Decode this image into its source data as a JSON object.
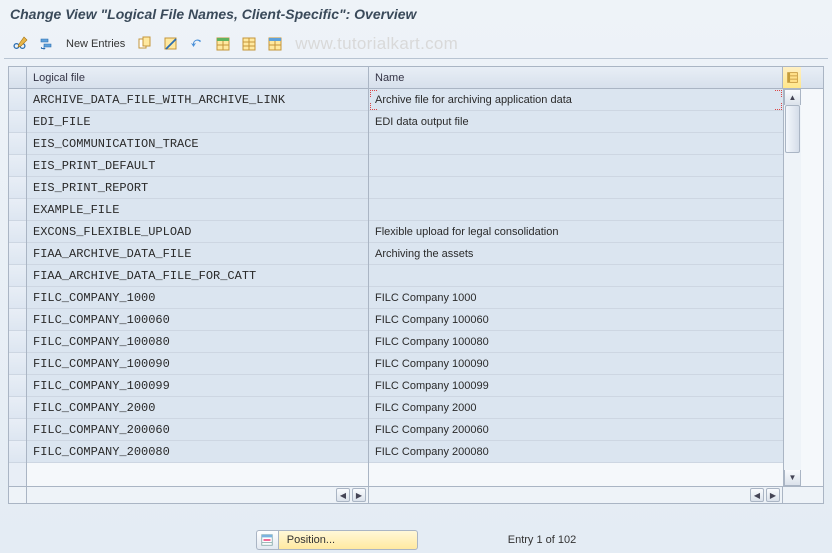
{
  "window_title": "Change View \"Logical File Names, Client-Specific\": Overview",
  "toolbar": {
    "new_entries_label": "New Entries"
  },
  "watermark_text": "www.tutorialkart.com",
  "columns": {
    "logical_file": "Logical file",
    "name": "Name"
  },
  "rows": [
    {
      "logical": "ARCHIVE_DATA_FILE_WITH_ARCHIVE_LINK",
      "name": "Archive file for archiving application data"
    },
    {
      "logical": "EDI_FILE",
      "name": "EDI data output file"
    },
    {
      "logical": "EIS_COMMUNICATION_TRACE",
      "name": ""
    },
    {
      "logical": "EIS_PRINT_DEFAULT",
      "name": ""
    },
    {
      "logical": "EIS_PRINT_REPORT",
      "name": ""
    },
    {
      "logical": "EXAMPLE_FILE",
      "name": ""
    },
    {
      "logical": "EXCONS_FLEXIBLE_UPLOAD",
      "name": "Flexible upload for legal consolidation"
    },
    {
      "logical": "FIAA_ARCHIVE_DATA_FILE",
      "name": "Archiving the assets"
    },
    {
      "logical": "FIAA_ARCHIVE_DATA_FILE_FOR_CATT",
      "name": ""
    },
    {
      "logical": "FILC_COMPANY_1000",
      "name": "FILC Company 1000"
    },
    {
      "logical": "FILC_COMPANY_100060",
      "name": "FILC Company 100060"
    },
    {
      "logical": "FILC_COMPANY_100080",
      "name": "FILC Company 100080"
    },
    {
      "logical": "FILC_COMPANY_100090",
      "name": "FILC Company 100090"
    },
    {
      "logical": "FILC_COMPANY_100099",
      "name": "FILC Company 100099"
    },
    {
      "logical": "FILC_COMPANY_2000",
      "name": "FILC Company 2000"
    },
    {
      "logical": "FILC_COMPANY_200060",
      "name": "FILC Company 200060"
    },
    {
      "logical": "FILC_COMPANY_200080",
      "name": "FILC Company 200080"
    }
  ],
  "footer": {
    "position_label": "Position...",
    "entry_text": "Entry 1 of 102"
  }
}
